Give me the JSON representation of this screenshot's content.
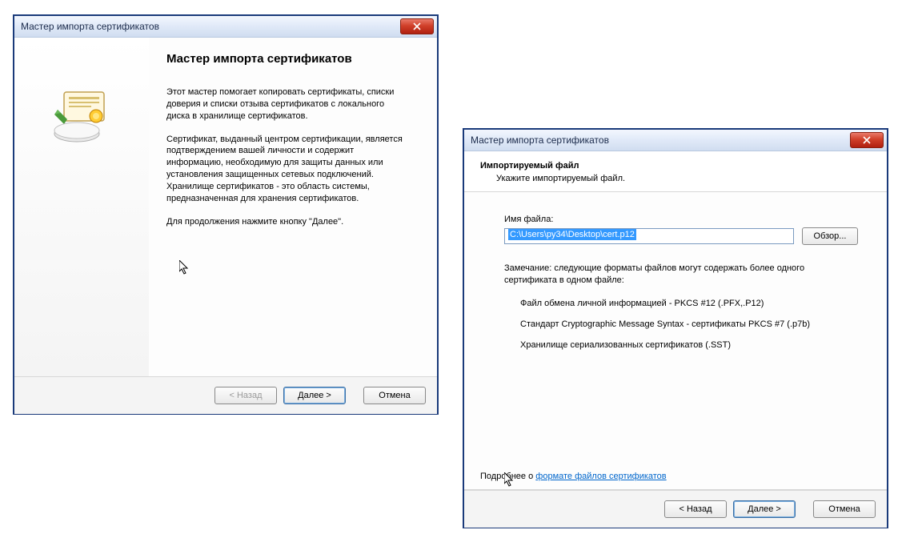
{
  "wizard1": {
    "title": "Мастер импорта сертификатов",
    "heading": "Мастер импорта сертификатов",
    "para1": "Этот мастер помогает копировать сертификаты, списки доверия и списки отзыва сертификатов с локального диска в хранилище сертификатов.",
    "para2": "Сертификат, выданный центром сертификации, является подтверждением вашей личности и содержит информацию, необходимую для защиты данных или установления защищенных сетевых подключений. Хранилище сертификатов - это область системы, предназначенная для хранения сертификатов.",
    "para3": "Для продолжения нажмите кнопку \"Далее\".",
    "buttons": {
      "back": "< Назад",
      "next": "Далее >",
      "cancel": "Отмена"
    }
  },
  "wizard2": {
    "title": "Мастер импорта сертификатов",
    "header_title": "Импортируемый файл",
    "header_sub": "Укажите импортируемый файл.",
    "field_label": "Имя файла:",
    "file_value": "C:\\Users\\py34\\Desktop\\cert.p12",
    "browse": "Обзор...",
    "note": "Замечание: следующие форматы файлов могут содержать более одного сертификата в одном файле:",
    "format1": "Файл обмена личной информацией - PKCS #12 (.PFX,.P12)",
    "format2": "Стандарт Cryptographic Message Syntax - сертификаты PKCS #7 (.p7b)",
    "format3": "Хранилище сериализованных сертификатов (.SST)",
    "learn_prefix": "Подробнее о ",
    "learn_link": "формате файлов сертификатов",
    "buttons": {
      "back": "< Назад",
      "next": "Далее >",
      "cancel": "Отмена"
    }
  }
}
